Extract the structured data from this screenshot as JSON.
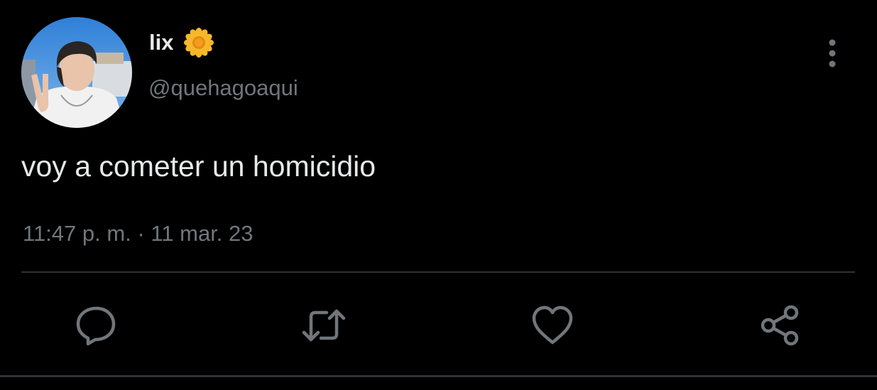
{
  "tweet": {
    "display_name": "lix",
    "name_emoji": "sunflower-emoji",
    "handle": "@quehagoaqui",
    "text": "voy a cometer un homicidio",
    "timestamp": "11:47 p. m. · 11 mar. 23"
  },
  "actions": [
    {
      "name": "reply",
      "icon": "speech-bubble-icon"
    },
    {
      "name": "retweet",
      "icon": "retweet-icon"
    },
    {
      "name": "like",
      "icon": "heart-icon"
    },
    {
      "name": "share",
      "icon": "share-icon"
    }
  ],
  "colors": {
    "background": "#000000",
    "primary_text": "#e7e9ea",
    "secondary_text": "#71767b",
    "divider": "#2f3336"
  }
}
